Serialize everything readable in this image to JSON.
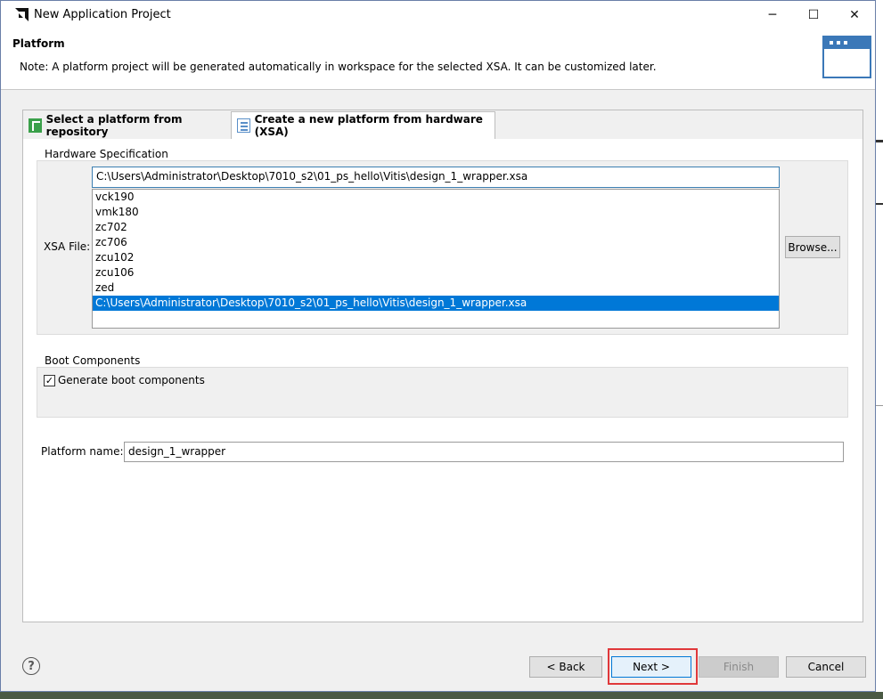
{
  "window": {
    "title": "New Application Project",
    "minimize_glyph": "─",
    "maximize_glyph": "☐",
    "close_glyph": "✕"
  },
  "header": {
    "title": "Platform",
    "note": "Note: A platform project will be generated automatically in workspace for the selected XSA. It can be customized later."
  },
  "tabs": [
    {
      "label": "Select a platform from repository",
      "icon": "repository-icon",
      "active": false
    },
    {
      "label": "Create a new platform from hardware (XSA)",
      "icon": "hardware-icon",
      "active": true
    }
  ],
  "hardware_spec": {
    "group_label": "Hardware Specification",
    "xsa_label": "XSA File:",
    "xsa_value": "C:\\Users\\Administrator\\Desktop\\7010_s2\\01_ps_hello\\Vitis\\design_1_wrapper.xsa",
    "xsa_options": [
      "vck190",
      "vmk180",
      "zc702",
      "zc706",
      "zcu102",
      "zcu106",
      "zed",
      "C:\\Users\\Administrator\\Desktop\\7010_s2\\01_ps_hello\\Vitis\\design_1_wrapper.xsa"
    ],
    "selected_index": 7,
    "browse_label": "Browse..."
  },
  "boot_components": {
    "group_label": "Boot Components",
    "checkbox_label": "Generate boot components",
    "checked": true,
    "check_glyph": "✓"
  },
  "platform_name": {
    "label": "Platform name:",
    "value": "design_1_wrapper"
  },
  "buttons": {
    "help_glyph": "?",
    "back": "< Back",
    "next": "Next >",
    "finish": "Finish",
    "cancel": "Cancel"
  },
  "colors": {
    "selection": "#0078d7",
    "highlight_box": "#e0383a",
    "header_graphic": "#3b78b8"
  }
}
